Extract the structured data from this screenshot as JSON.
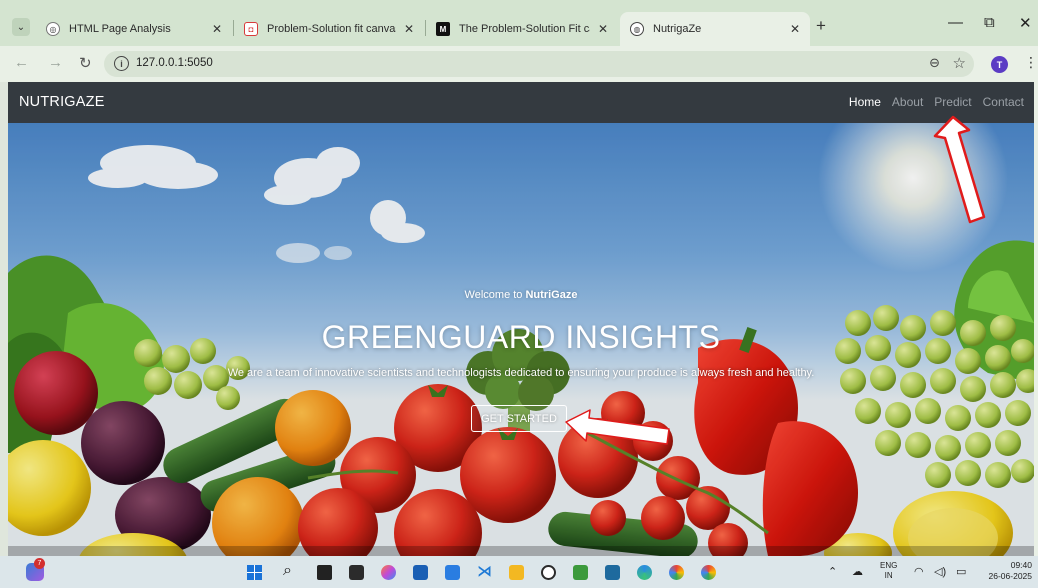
{
  "browser": {
    "tabs": [
      {
        "title": "HTML Page Analysis",
        "favicon": "globe-icon"
      },
      {
        "title": "Problem-Solution fit canvas — [",
        "favicon": "canvas-icon"
      },
      {
        "title": "The Problem-Solution Fit canva",
        "favicon": "medium-icon"
      },
      {
        "title": "NutrigaZe",
        "favicon": "globe-icon",
        "active": true
      }
    ],
    "url": "127.0.0.1:5050",
    "profile_initial": "T"
  },
  "site": {
    "brand": "NUTRIGAZE",
    "nav": [
      "Home",
      "About",
      "Predict",
      "Contact"
    ],
    "active_nav": "Home",
    "welcome_prefix": "Welcome to ",
    "welcome_brand": "NutriGaze",
    "headline": "GREENGUARD INSIGHTS",
    "tagline": "We are a team of innovative scientists and technologists dedicated to ensuring your produce is always fresh and healthy.",
    "cta_label": "GET STARTED"
  },
  "taskbar": {
    "notification_count": "7",
    "lang_top": "ENG",
    "lang_bottom": "IN",
    "time": "09:40",
    "date": "26-06-2025"
  },
  "colors": {
    "navbar": "#343a40",
    "annotation_arrow": "#e01b1b"
  }
}
